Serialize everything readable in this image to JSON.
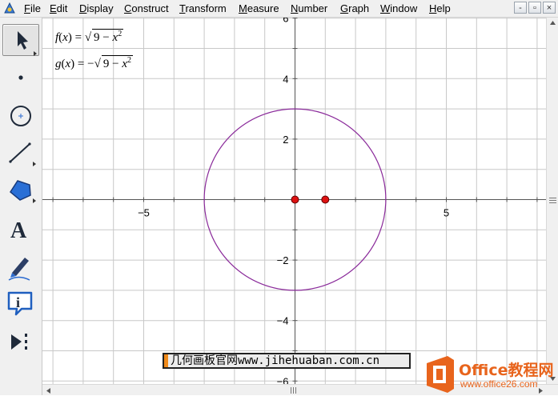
{
  "menubar": {
    "items": [
      {
        "label": "File",
        "accel": "F",
        "rest": "ile"
      },
      {
        "label": "Edit",
        "accel": "E",
        "rest": "dit"
      },
      {
        "label": "Display",
        "accel": "D",
        "rest": "isplay"
      },
      {
        "label": "Construct",
        "accel": "C",
        "rest": "onstruct"
      },
      {
        "label": "Transform",
        "accel": "T",
        "rest": "ransform"
      },
      {
        "label": "Measure",
        "accel": "M",
        "rest": "easure"
      },
      {
        "label": "Number",
        "accel": "N",
        "rest": "umber"
      },
      {
        "label": "Graph",
        "accel": "G",
        "rest": "raph"
      },
      {
        "label": "Window",
        "accel": "W",
        "rest": "indow"
      },
      {
        "label": "Help",
        "accel": "H",
        "rest": "elp"
      }
    ],
    "window_buttons": [
      "-",
      "▫",
      "×"
    ]
  },
  "toolbox": {
    "tools": [
      "arrow-tool",
      "point-tool",
      "compass-tool",
      "straightedge-tool",
      "polygon-tool",
      "text-tool",
      "marker-tool",
      "information-tool",
      "custom-tool"
    ],
    "text_tool_glyph": "A",
    "info_tool_glyph": "i",
    "selected": "arrow-tool"
  },
  "functions": {
    "f": {
      "name": "f",
      "var": "x",
      "eq": "=",
      "radicand_const": "9 −",
      "radicand_var": "x",
      "exp": "2",
      "sign": ""
    },
    "g": {
      "name": "g",
      "var": "x",
      "eq": "=",
      "radicand_const": "9 −",
      "radicand_var": "x",
      "exp": "2",
      "sign": "−"
    }
  },
  "graph": {
    "x_ticks": [
      {
        "v": -5,
        "label": "−5"
      },
      {
        "v": 5,
        "label": "5"
      }
    ],
    "y_ticks": [
      {
        "v": 6,
        "label": "6"
      },
      {
        "v": 4,
        "label": "4"
      },
      {
        "v": 2,
        "label": "2"
      },
      {
        "v": -2,
        "label": "−2"
      },
      {
        "v": -4,
        "label": "−4"
      },
      {
        "v": -6,
        "label": "−6"
      }
    ],
    "circle_radius": 3,
    "points": [
      {
        "x": 0,
        "y": 0
      },
      {
        "x": 1,
        "y": 0
      }
    ],
    "grid": true,
    "colors": {
      "grid": "#c8c8c8",
      "axis": "#555555",
      "circle": "#8a2a9a",
      "point": "#dd1111"
    }
  },
  "watermark": {
    "text": "几何画板官网www.jihehuaban.com.cn"
  },
  "office_logo": {
    "brand": "Office教程网",
    "url": "www.office26.com",
    "color": "#e8641c"
  }
}
